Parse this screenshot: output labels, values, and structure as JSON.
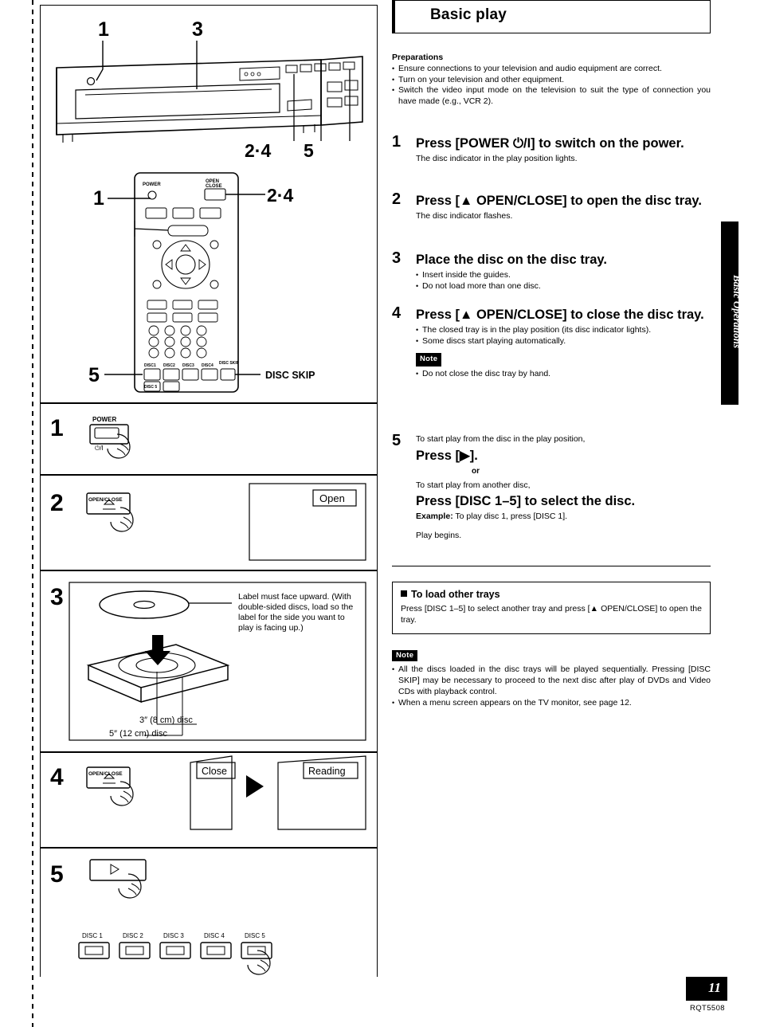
{
  "page": {
    "number": "11",
    "code": "RQT5508",
    "side_tab": "Basic Operations"
  },
  "title": "Basic play",
  "preparations": {
    "heading": "Preparations",
    "items": [
      "Ensure connections to your television and audio equipment are correct.",
      "Turn on your television and other equipment.",
      "Switch the video input mode on the television to suit the type of connection you have made (e.g., VCR 2)."
    ]
  },
  "steps": [
    {
      "num": "1",
      "head": "Press [POWER ⏻/I] to switch on the power.",
      "sub": [
        "The disc indicator in the play position lights."
      ]
    },
    {
      "num": "2",
      "head": "Press [▲ OPEN/CLOSE] to open the disc tray.",
      "sub": [
        "The disc indicator flashes."
      ]
    },
    {
      "num": "3",
      "head": "Place the disc on the disc tray.",
      "bullets": [
        "Insert inside the guides.",
        "Do not load more than one disc."
      ]
    },
    {
      "num": "4",
      "head": "Press [▲ OPEN/CLOSE] to close the disc tray.",
      "bullets": [
        "The closed tray is in the play position (its disc indicator lights).",
        "Some discs start playing automatically."
      ],
      "note_tag": "Note",
      "note_bullets": [
        "Do not close the disc tray by hand."
      ]
    },
    {
      "num": "5",
      "lead": "To start play from the disc in the play position,",
      "head": "Press [▶].",
      "or": "or",
      "lead2": "To start play from another disc,",
      "head2": "Press [DISC 1–5] to select the disc.",
      "example_label": "Example:",
      "example_text": "To play disc 1, press [DISC 1].",
      "tail": "Play begins."
    }
  ],
  "load_other_trays": {
    "heading": "To load other trays",
    "body": "Press [DISC 1–5] to select another tray and press [▲ OPEN/CLOSE] to open the tray."
  },
  "bottom_note": {
    "tag": "Note",
    "items": [
      "All the discs loaded in the disc trays will be played sequentially. Pressing [DISC SKIP] may be necessary to proceed to the next disc after play of DVDs and Video CDs with playback control.",
      "When a menu screen appears on the TV monitor, see page 12."
    ]
  },
  "illustrations": {
    "callouts": {
      "c1_top": "1",
      "c3_top": "3",
      "c24_device": "2·4",
      "c5_device": "5",
      "c1_remote": "1",
      "c24_remote": "2·4",
      "c5_remote": "5",
      "disc_skip_label": "DISC SKIP"
    },
    "remote": {
      "power_label": "POWER",
      "open_close_label": "OPEN\nCLOSE"
    },
    "step1": {
      "num": "1",
      "key_label": "POWER",
      "key_sub": "⏻/I"
    },
    "step2": {
      "num": "2",
      "key_label": "OPEN/CLOSE",
      "display": "Open"
    },
    "step3": {
      "num": "3",
      "label_note": "Label must face upward. (With double-sided discs, load so the label for the side you want to play is facing up.)",
      "disc_small": "3″ (8 cm) disc",
      "disc_large": "5″ (12 cm) disc"
    },
    "step4": {
      "num": "4",
      "key_label": "OPEN/CLOSE",
      "display1": "Close",
      "display2": "Reading"
    },
    "step5": {
      "num": "5",
      "disc_buttons": [
        "DISC 1",
        "DISC 2",
        "DISC 3",
        "DISC 4",
        "DISC 5"
      ]
    }
  }
}
